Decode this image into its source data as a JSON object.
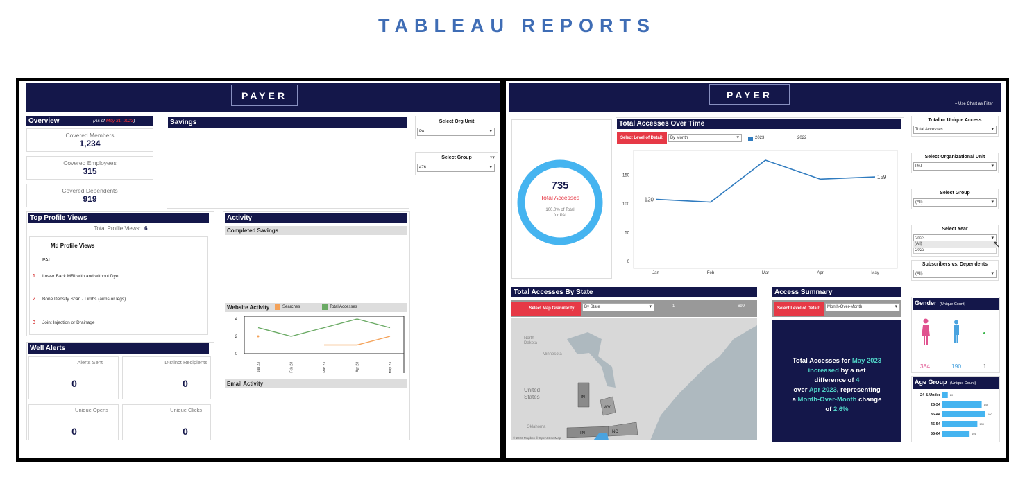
{
  "page_title": "TABLEAU REPORTS",
  "left": {
    "banner": "PAYER",
    "overview": {
      "title": "Overview",
      "as_of_prefix": "(As of ",
      "as_of_date": "May 31, 2023",
      "as_of_suffix": ")"
    },
    "cards": [
      {
        "label": "Covered Members",
        "value": "1,234"
      },
      {
        "label": "Covered Employees",
        "value": "315"
      },
      {
        "label": "Covered Dependents",
        "value": "919"
      }
    ],
    "savings_title": "Savings",
    "filters": {
      "org_unit_label": "Select Org Unit",
      "org_unit_value": "PAI",
      "group_label": "Select Group",
      "group_value": "476"
    },
    "top_profile": {
      "title": "Top Profile Views",
      "total_label": "Total Profile Views:",
      "total_value": "6",
      "column_header": "Md Profile Views",
      "org": "PAI",
      "items": [
        {
          "rank": "1",
          "name": "Lower Back MRI with and without Dye"
        },
        {
          "rank": "2",
          "name": "Bone Density Scan - Limbs (arms or legs)"
        },
        {
          "rank": "3",
          "name": "Joint Injection or Drainage"
        }
      ]
    },
    "activity": {
      "title": "Activity",
      "completed_savings": "Completed Savings",
      "website_activity": "Website Activity",
      "legend_searches": "Searches",
      "legend_total": "Total Accesses",
      "email_activity": "Email Activity"
    },
    "well_alerts": {
      "title": "Well Alerts",
      "cells": [
        {
          "label": "Alerts Sent",
          "value": "0"
        },
        {
          "label": "Distinct Recipients",
          "value": "0"
        },
        {
          "label": "Unique Opens",
          "value": "0"
        },
        {
          "label": "Unique Clicks",
          "value": "0"
        }
      ]
    }
  },
  "right": {
    "banner": "PAYER",
    "chart_filter_note": "= Use Chart as Filter",
    "donut": {
      "value": "735",
      "label": "Total Accesses",
      "pct_line": "100.0% of Total",
      "for_line": "for PAI",
      "fraction": 1.0
    },
    "tat": {
      "title": "Total Accesses Over Time",
      "level_label": "Select Level of Detail:",
      "level_value": "By Month",
      "legend_2023": "2023",
      "legend_2022": "2022"
    },
    "filters": {
      "total_unique_label": "Total or Unique Access",
      "total_unique_value": "Total Accesses",
      "org_label": "Select Organizational Unit",
      "org_value": "PAI",
      "group_label": "Select Group",
      "group_value": "(All)",
      "year_label": "Select Year",
      "year_value": "2023",
      "year_options": [
        "(All)",
        "2023"
      ],
      "subs_label": "Subscribers vs. Dependents",
      "subs_value": "(All)"
    },
    "state": {
      "title": "Total Accesses By State",
      "granularity_label": "Select Map Granularity:",
      "granularity_value": "By State",
      "range_min": "1",
      "range_max": "699",
      "map_labels": {
        "north": "North",
        "dakota": "Dakota",
        "minnesota": "Minnesota",
        "united": "United",
        "states": "States",
        "in": "IN",
        "wv": "WV",
        "tn": "TN",
        "nc": "NC",
        "oklahoma": "Oklahoma"
      },
      "copyright": "© 2023 Mapbox © OpenStreetMap"
    },
    "summary": {
      "title": "Access Summary",
      "level_label": "Select Level of Detail:",
      "level_value": "Month-Over-Month",
      "text_1": "Total Accesses for ",
      "month": "May 2023",
      "text_2": "increased",
      "text_3": " by a net",
      "text_4": "difference of ",
      "diff": "4",
      "text_5": "over ",
      "prev": "Apr 2023",
      "text_6": ", representing",
      "text_7": "a ",
      "mom": "Month-Over-Month",
      "text_8": " change",
      "text_9": "of ",
      "pct": "2.6%"
    },
    "gender": {
      "title": "Gender",
      "subtitle": "(Unique Count)",
      "female": "384",
      "male": "190",
      "other": "1"
    },
    "age": {
      "title": "Age Group",
      "subtitle": "(Unique Count)",
      "groups": [
        {
          "label": "24 & Under",
          "value": "20"
        },
        {
          "label": "25-34",
          "value": "146"
        },
        {
          "label": "35-44",
          "value": "160"
        },
        {
          "label": "45-54",
          "value": "130"
        },
        {
          "label": "55-64",
          "value": "101"
        }
      ]
    }
  },
  "chart_data": [
    {
      "type": "line",
      "title": "Website Activity",
      "categories": [
        "Jan 23",
        "Feb 23",
        "Mar 23",
        "Apr 23",
        "May 23"
      ],
      "series": [
        {
          "name": "Searches",
          "values": [
            2,
            null,
            1,
            1,
            2
          ],
          "color": "#f4a259"
        },
        {
          "name": "Total Accesses",
          "values": [
            3,
            2,
            3,
            4,
            3
          ],
          "color": "#6aaa64"
        }
      ],
      "ylim": [
        0,
        4
      ],
      "yticks": [
        0,
        2,
        4
      ]
    },
    {
      "type": "line",
      "title": "Total Accesses Over Time",
      "categories": [
        "Jan",
        "Feb",
        "Mar",
        "Apr",
        "May"
      ],
      "series": [
        {
          "name": "2023",
          "values": [
            120,
            115,
            188,
            155,
            159
          ],
          "color": "#2f7bbf"
        }
      ],
      "point_labels": {
        "0": "120",
        "4": "159"
      },
      "ylim": [
        0,
        200
      ],
      "yticks": [
        0,
        50,
        100,
        150
      ]
    },
    {
      "type": "bar",
      "title": "Age Group",
      "categories": [
        "24 & Under",
        "25-34",
        "35-44",
        "45-54",
        "55-64"
      ],
      "values": [
        20,
        146,
        160,
        130,
        101
      ],
      "orientation": "horizontal"
    }
  ]
}
